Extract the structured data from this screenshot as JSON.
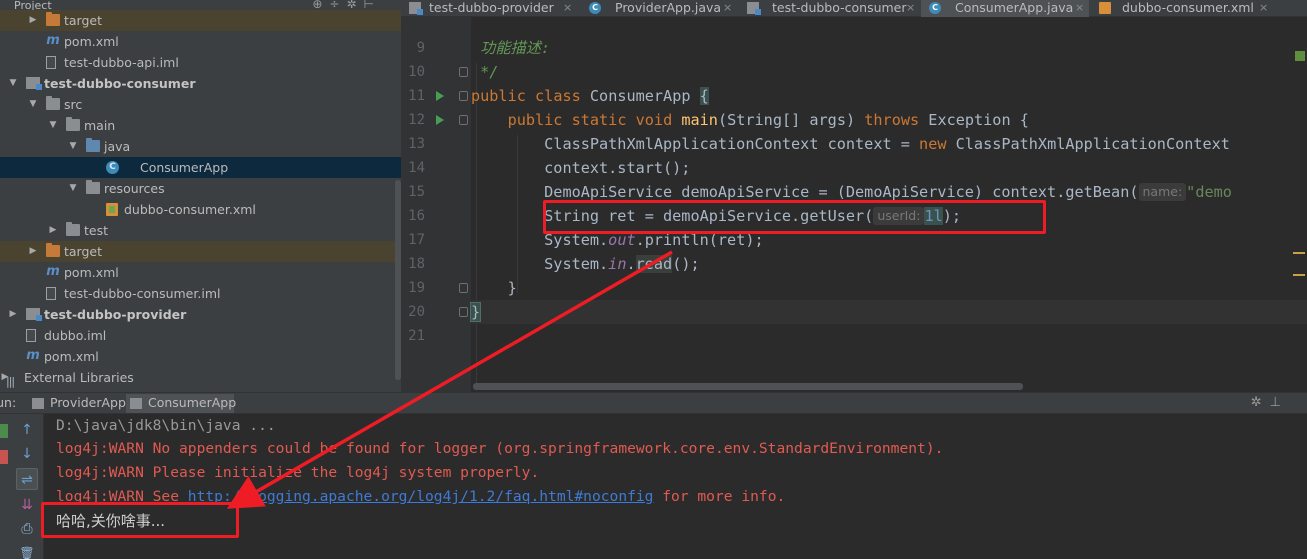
{
  "project_panel": {
    "title": "Project",
    "tool_icons": [
      "globe-icon",
      "collapse-icon",
      "gear-icon",
      "hide-icon"
    ],
    "tree": [
      {
        "label": "target",
        "icon": "folder-excluded-icon",
        "arrow": "▶",
        "bold": false
      },
      {
        "label": "pom.xml",
        "icon": "maven-icon",
        "arrow": "",
        "bold": false
      },
      {
        "label": "test-dubbo-api.iml",
        "icon": "iml-file-icon",
        "arrow": "",
        "bold": false
      },
      {
        "label": "test-dubbo-consumer",
        "icon": "module-folder-icon",
        "arrow": "▼",
        "bold": true
      },
      {
        "label": "src",
        "icon": "folder-icon",
        "arrow": "▼",
        "bold": false
      },
      {
        "label": "main",
        "icon": "folder-icon",
        "arrow": "▼",
        "bold": false
      },
      {
        "label": "java",
        "icon": "source-folder-icon",
        "arrow": "▼",
        "bold": false
      },
      {
        "label": "ConsumerApp",
        "icon": "java-class-icon",
        "arrow": "",
        "bold": false
      },
      {
        "label": "resources",
        "icon": "resources-folder-icon",
        "arrow": "▼",
        "bold": false
      },
      {
        "label": "dubbo-consumer.xml",
        "icon": "xml-file-icon",
        "arrow": "",
        "bold": false
      },
      {
        "label": "test",
        "icon": "folder-icon",
        "arrow": "▶",
        "bold": false
      },
      {
        "label": "target",
        "icon": "folder-excluded-icon",
        "arrow": "▶",
        "bold": false
      },
      {
        "label": "pom.xml",
        "icon": "maven-icon",
        "arrow": "",
        "bold": false
      },
      {
        "label": "test-dubbo-consumer.iml",
        "icon": "iml-file-icon",
        "arrow": "",
        "bold": false
      },
      {
        "label": "test-dubbo-provider",
        "icon": "module-folder-icon",
        "arrow": "▶",
        "bold": true
      },
      {
        "label": "dubbo.iml",
        "icon": "iml-file-icon",
        "arrow": "",
        "bold": false
      },
      {
        "label": "pom.xml",
        "icon": "maven-icon",
        "arrow": "",
        "bold": false
      },
      {
        "label": "External Libraries",
        "icon": "libraries-icon",
        "arrow": "▶",
        "bold": false
      }
    ]
  },
  "editor_tabs": [
    {
      "label": "test-dubbo-provider",
      "icon": "module-icon",
      "active": false
    },
    {
      "label": "ProviderApp.java",
      "icon": "java-class-icon",
      "active": false
    },
    {
      "label": "test-dubbo-consumer",
      "icon": "module-icon",
      "active": false
    },
    {
      "label": "ConsumerApp.java",
      "icon": "java-class-icon",
      "active": true
    },
    {
      "label": "dubbo-consumer.xml",
      "icon": "xml-file-icon",
      "active": false
    }
  ],
  "tab_close_glyph": "×",
  "editor": {
    "line_numbers": [
      "9",
      "10",
      "11",
      "12",
      "13",
      "14",
      "15",
      "16",
      "17",
      "18",
      "19",
      "20",
      "21"
    ],
    "line9_comment": "功能描述:",
    "line10_comment": "*/",
    "line11": {
      "kw1": "public",
      "kw2": "class",
      "name": "ConsumerApp",
      "brace": "{"
    },
    "line12": {
      "kw1": "public",
      "kw2": "static",
      "kw3": "void",
      "fn": "main",
      "params": "(String[] args)",
      "kw4": "throws",
      "rest": "Exception {"
    },
    "line13": {
      "pre": "ClassPathXmlApplicationContext context = ",
      "kw": "new",
      "post": "ClassPathXmlApplicationContext"
    },
    "line14": "context.start();",
    "line15": {
      "pre": "DemoApiService demoApiService = (DemoApiService) context.getBean(",
      "hint": "name:",
      "str": "\"demo"
    },
    "line16": {
      "pre": "String ret = demoApiService.getUser(",
      "hint": "userId:",
      "num": "1l",
      "post": ");"
    },
    "line17": {
      "pre": "System.",
      "field": "out",
      "post": ".println(ret);"
    },
    "line18": {
      "pre": "System.",
      "field": "in",
      "mid": ".",
      "hl": "read",
      "post": "();"
    },
    "line19": "}",
    "line20": "}"
  },
  "run_panel": {
    "label": "Run:",
    "tabs": [
      {
        "label": "ProviderApp",
        "active": false
      },
      {
        "label": "ConsumerApp",
        "active": true
      }
    ],
    "toolbar_icons": [
      "rerun-icon",
      "stop-icon",
      "up-arrow-icon",
      "down-arrow-icon",
      "soft-wrap-icon",
      "scroll-to-end-icon",
      "print-icon",
      "trash-icon"
    ],
    "toolbar_glyphs": [
      "↑",
      "↓",
      "⇌",
      "⇊",
      "⎙",
      "🗑"
    ],
    "header_icons": [
      "gear-icon",
      "minimize-icon"
    ],
    "console": {
      "cmd": "D:\\java\\jdk8\\bin\\java ...",
      "warn1": "log4j:WARN No appenders could be found for logger (org.springframework.core.env.StandardEnvironment).",
      "warn2": "log4j:WARN Please initialize the log4j system properly.",
      "warn3_pre": "log4j:WARN See ",
      "warn3_link": "http://logging.apache.org/log4j/1.2/faq.html#noconfig",
      "warn3_post": " for more info.",
      "output": "哈哈,关你啥事..."
    }
  },
  "colors": {
    "annotation_red": "#ee1c24",
    "keyword": "#cc7832",
    "function": "#ffc66d",
    "error_text": "#e05a52",
    "link": "#3e7bd6"
  }
}
